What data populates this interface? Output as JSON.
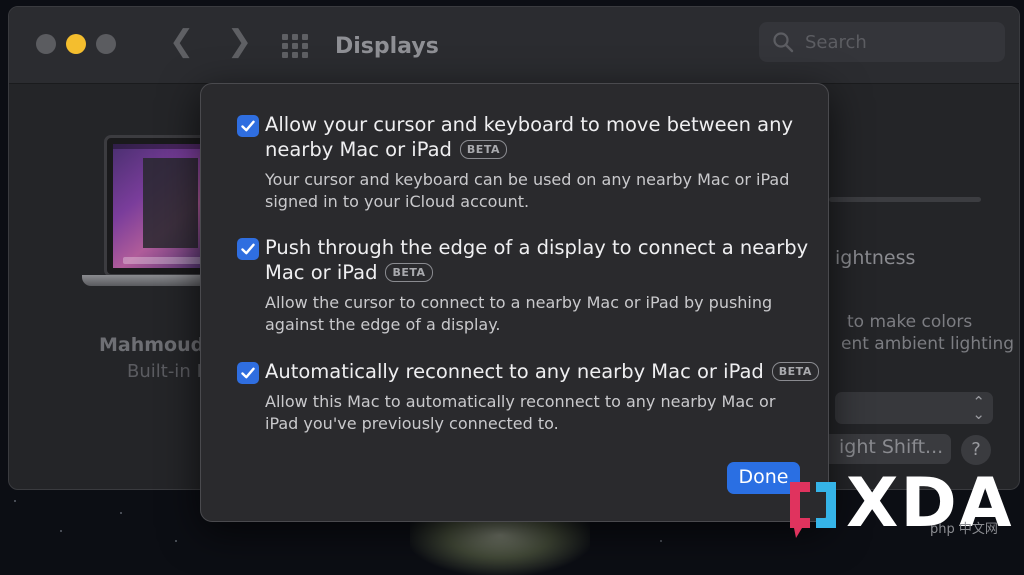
{
  "window": {
    "title": "Displays",
    "search_placeholder": "Search"
  },
  "display": {
    "name": "Mahmoud's",
    "type": "Built-in R"
  },
  "background_right": {
    "brightness_label": "ightness",
    "ambient_line1": "to make colors",
    "ambient_line2": "ent ambient lighting",
    "night_shift_label": "ight Shift...",
    "help_label": "?"
  },
  "sheet": {
    "options": [
      {
        "checked": true,
        "title_line1": "Allow your cursor and keyboard to move between any",
        "title_line2": "nearby Mac or iPad",
        "badge": "BETA",
        "desc_line1": "Your cursor and keyboard can be used on any nearby Mac or iPad",
        "desc_line2": "signed in to your iCloud account."
      },
      {
        "checked": true,
        "title_line1": "Push through the edge of a display to connect a nearby",
        "title_line2": "Mac or iPad",
        "badge": "BETA",
        "desc_line1": "Allow the cursor to connect to a nearby Mac or iPad by pushing",
        "desc_line2": "against the edge of a display."
      },
      {
        "checked": true,
        "title_line1": "Automatically reconnect to any nearby Mac or iPad",
        "badge": "BETA",
        "desc_line1": "Allow this Mac to automatically reconnect to any nearby Mac or",
        "desc_line2": "iPad you've previously connected to."
      }
    ],
    "done_label": "Done"
  },
  "watermark": {
    "logo_text": "XDA",
    "site_text": "php 中文网"
  },
  "colors": {
    "accent": "#2a6fe3",
    "minimize": "#f4be2e"
  }
}
